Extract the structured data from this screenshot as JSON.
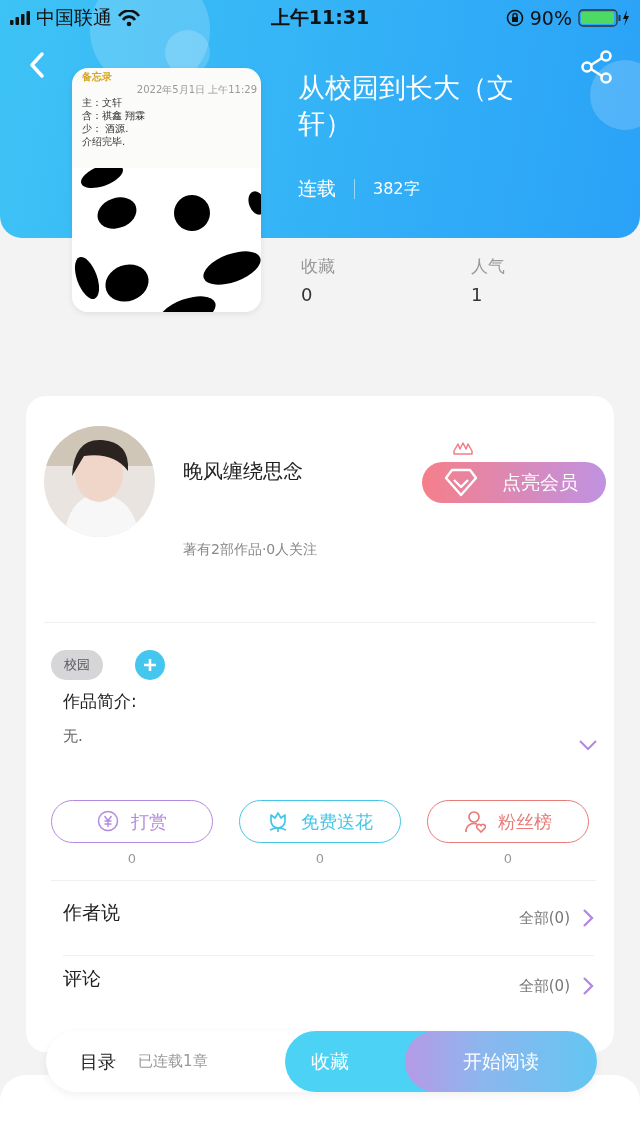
{
  "status_bar": {
    "carrier": "中国联通",
    "time": "上午11:31",
    "battery": "90%"
  },
  "header": {
    "title": "从校园到长大（文轩）",
    "status": "连载",
    "word_count": "382字"
  },
  "cover": {
    "app": "备忘录",
    "date": "2022年5月1日 上午11:29",
    "lines": [
      "主：文轩",
      "含：祺鑫 翔霖",
      "少：  酒源.",
      "介绍完毕."
    ]
  },
  "stats": [
    {
      "label": "收藏",
      "value": "0"
    },
    {
      "label": "人气",
      "value": "1"
    }
  ],
  "author": {
    "name": "晚风缠绕思念",
    "info": "著有2部作品·0人关注",
    "member_button": "点亮会员"
  },
  "tags": [
    {
      "label": "校园"
    }
  ],
  "synopsis": {
    "label": "作品简介:",
    "text": "无.",
    "expanded": false
  },
  "actions": [
    {
      "kind": "tip",
      "label": "打赏",
      "count": "0",
      "color": "#b48ae0"
    },
    {
      "kind": "flower",
      "label": "免费送花",
      "count": "0",
      "color": "#45c6e6"
    },
    {
      "kind": "fans",
      "label": "粉丝榜",
      "count": "0",
      "color": "#e77c78"
    }
  ],
  "sections": [
    {
      "title": "作者说",
      "link": "全部(0)"
    },
    {
      "title": "评论",
      "link": "全部(0)"
    }
  ],
  "bottom_bar": {
    "catalog": "目录",
    "chapters": "已连载1章",
    "collect": "收藏",
    "read": "开始阅读"
  }
}
